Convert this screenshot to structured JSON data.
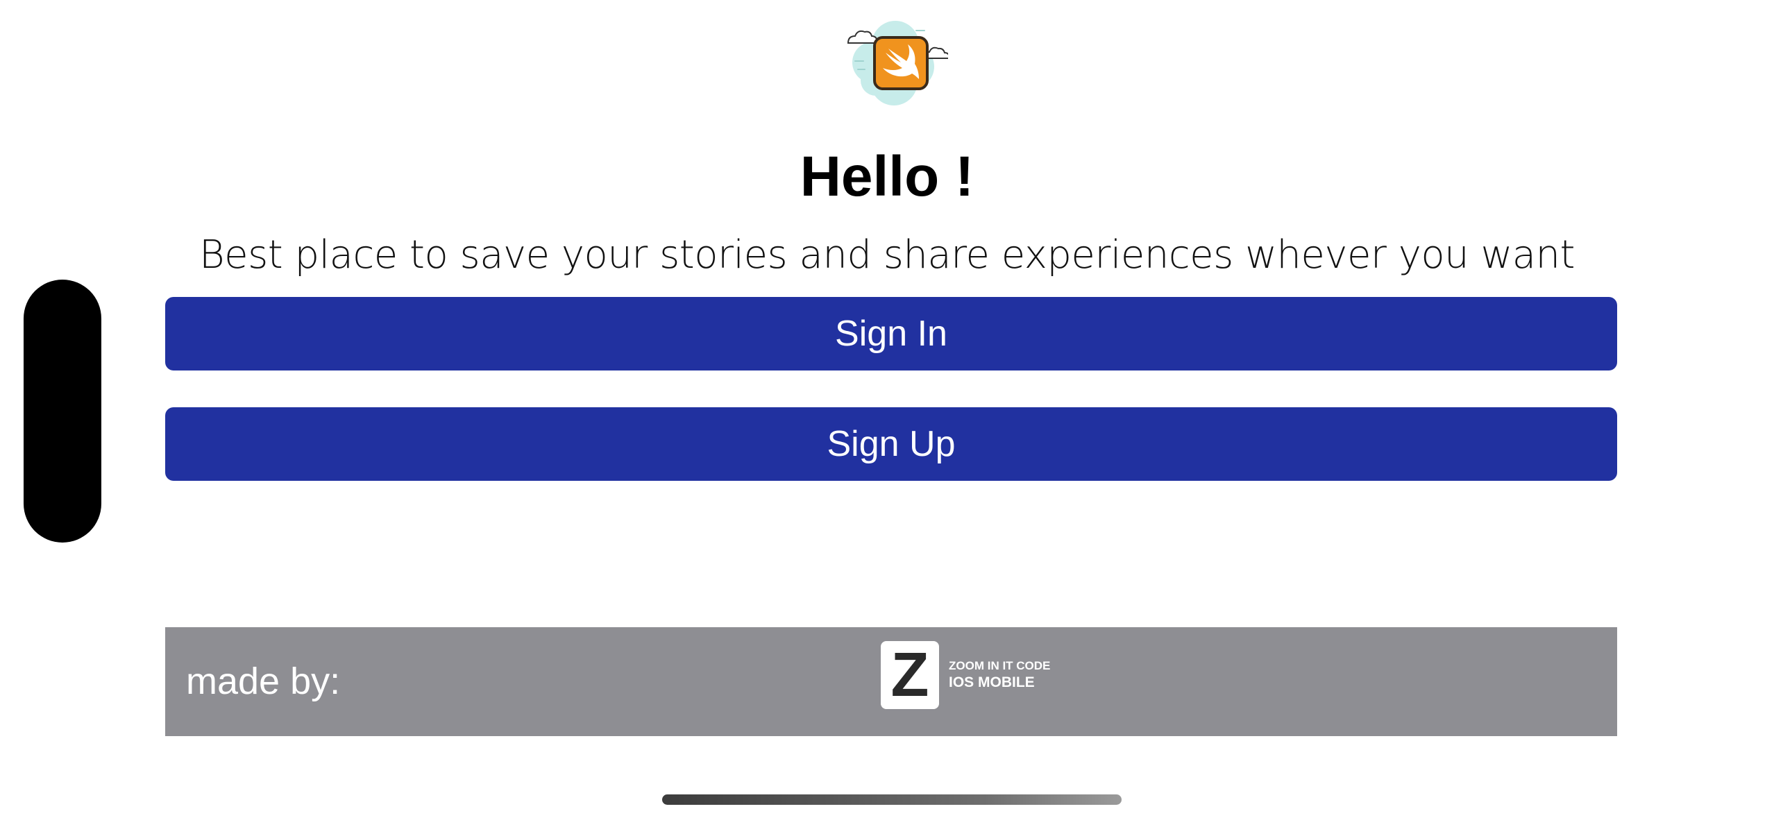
{
  "welcome": {
    "title": "Hello !",
    "subtitle": "Best place to save your stories and share experiences whever you want"
  },
  "actions": {
    "sign_in_label": "Sign In",
    "sign_up_label": "Sign Up"
  },
  "footer": {
    "made_by_label": "made by:",
    "brand_letter": "Z",
    "brand_line1": "ZOOM IN IT CODE",
    "brand_line2": "IOS MOBILE"
  },
  "icons": {
    "logo": "swift-bird-logo-icon"
  },
  "colors": {
    "button": "#2131a0",
    "footer": "#8e8e93",
    "logo_orange": "#f0931e"
  }
}
